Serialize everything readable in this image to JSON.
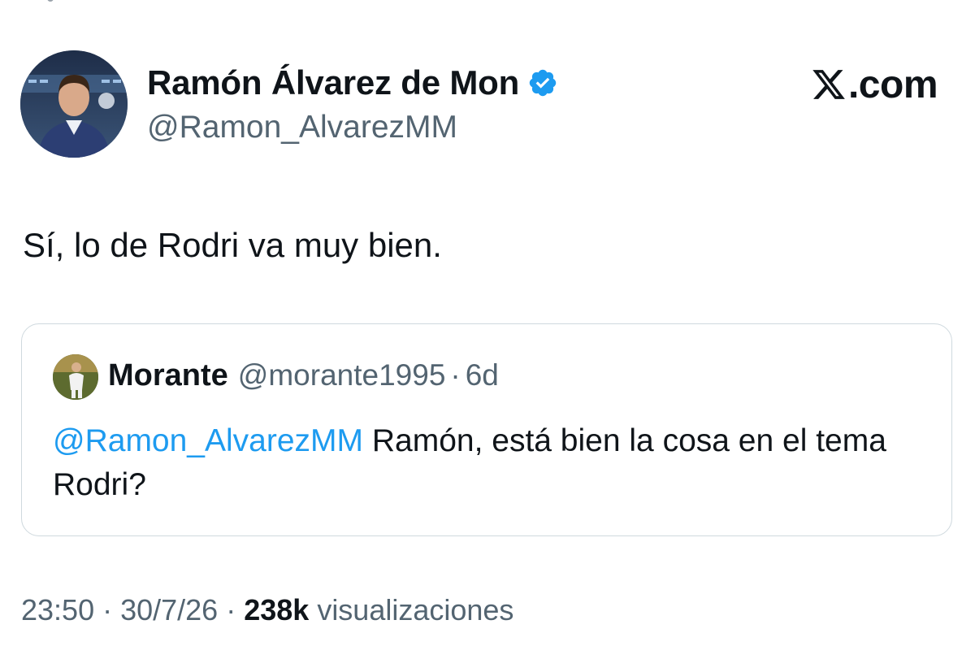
{
  "author": {
    "name": "Ramón Álvarez de Mon",
    "handle": "@Ramon_AlvarezMM",
    "verified_icon": "verified-badge-icon",
    "verified_color": "#1d9bf0"
  },
  "brand": {
    "text": ".com",
    "icon": "x-logo-icon"
  },
  "tweet": {
    "text": "Sí, lo de Rodri va muy bien."
  },
  "quote": {
    "name": "Morante",
    "handle": "@morante1995",
    "separator": "·",
    "age": "6d",
    "mention": "@Ramon_AlvarezMM",
    "text": " Ramón, está bien la cosa en el tema Rodri?"
  },
  "meta": {
    "time": "23:50",
    "separator": "·",
    "date": "30/7/26",
    "views_count": "238k",
    "views_label": "visualizaciones"
  },
  "colors": {
    "text": "#0f1419",
    "secondary": "#536471",
    "link": "#1d9bf0",
    "border": "#cfd9de"
  }
}
